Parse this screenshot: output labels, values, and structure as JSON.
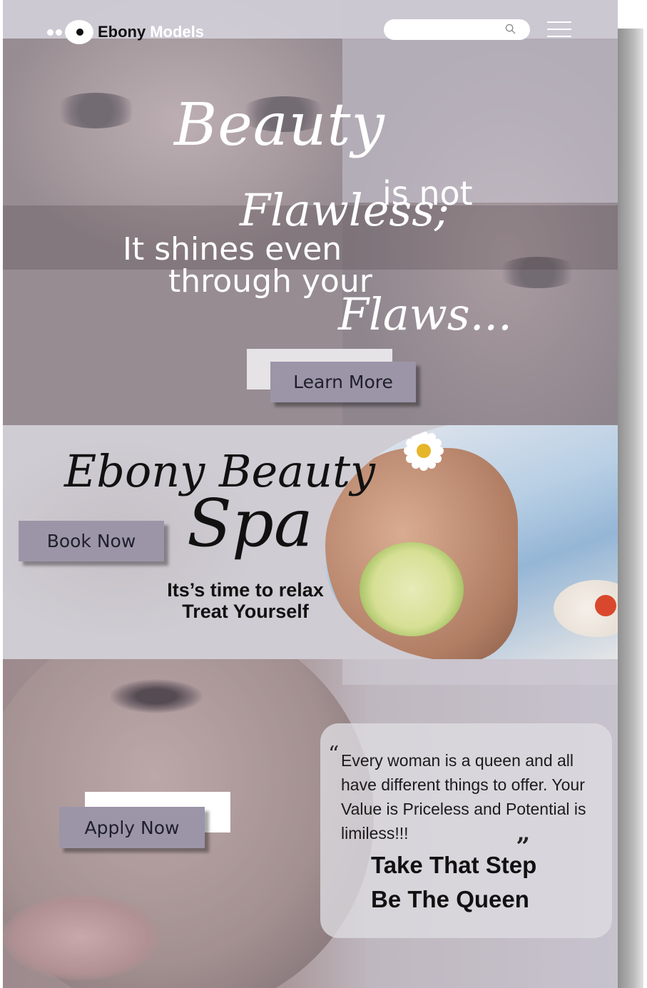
{
  "header": {
    "logo_word1": "Ebony",
    "logo_word2": "Models",
    "search": {
      "placeholder": "",
      "icon": "search-icon"
    },
    "menu_icon": "hamburger-menu-icon"
  },
  "hero": {
    "word_beauty": "Beauty",
    "word_isnot": "is not",
    "word_flawless": "Flawless;",
    "line_shines": "It shines even",
    "line_through": "through your",
    "word_flaws": "Flaws...",
    "learn_more_label": "Learn More"
  },
  "spa": {
    "title_line1": "Ebony Beauty",
    "title_line2": "Spa",
    "book_now_label": "Book Now",
    "subtitle_line1": "Its’s time to relax",
    "subtitle_line2": "Treat Yourself"
  },
  "bottom": {
    "apply_now_label": "Apply Now",
    "quote_open": "“",
    "quote_text": "Every woman is a queen and all have different things to offer. Your Value is Priceless and Potential is limiless!!!",
    "quote_close": "„",
    "cta_line1": "Take That Step",
    "cta_line2": "Be The Queen"
  },
  "colors": {
    "button_fill": "#9c95a8",
    "overlay": "#d6d3de",
    "text_dark": "#111111",
    "text_light": "#ffffff"
  }
}
